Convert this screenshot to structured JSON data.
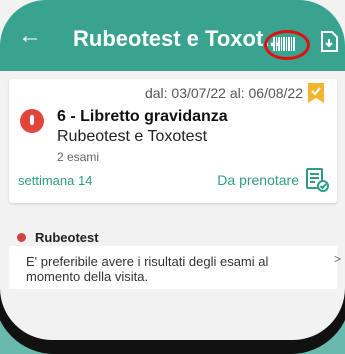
{
  "appbar": {
    "title": "Rubeotest e Toxot...",
    "back_icon": "arrow-left-icon",
    "barcode_icon": "barcode-icon",
    "download_icon": "download-icon",
    "color": "#3aa38f"
  },
  "card": {
    "date_range": "dal: 03/07/22 al: 06/08/22",
    "title": "6 - Libretto gravidanza",
    "subtitle": "Rubeotest e Toxotest",
    "count": "2 esami",
    "week": "settimana 14",
    "action": "Da prenotare",
    "bookmark_icon": "bookmark-check-icon",
    "book_icon": "checklist-icon"
  },
  "section": {
    "title": "Rubeotest",
    "note": "E' preferibile avere i risultati degli esami al momento della visita.",
    "chevron": ">"
  }
}
